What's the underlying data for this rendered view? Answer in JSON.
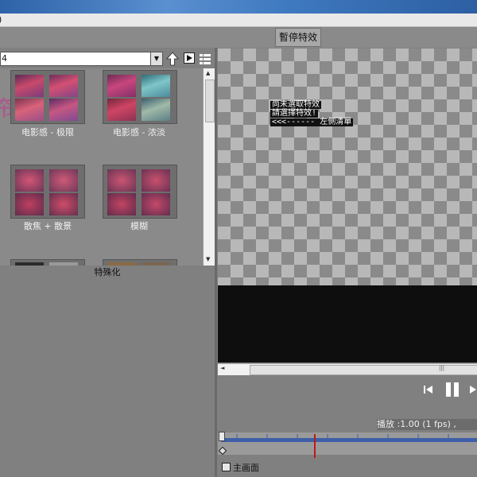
{
  "titlebar": {
    "title": ")"
  },
  "header": {
    "stop_effect_button": "暫停特效"
  },
  "browser": {
    "combo_value": "4",
    "tiles": [
      {
        "label": "电影感 - 极限"
      },
      {
        "label": "电影感 - 浓淡"
      },
      {
        "label": "散焦 + 散景"
      },
      {
        "label": "模糊"
      }
    ],
    "caption": "特殊化"
  },
  "preview": {
    "message_lines": [
      "尚未選取特效",
      "請選擇特效!",
      "<<<------ 左側清單"
    ]
  },
  "transport": {
    "status_text": "播放 :1.00 (1    fps) ,"
  },
  "options": {
    "main_screen_label": "主画面"
  },
  "colors": {
    "timeline_bar": "#3f5fa8",
    "playhead": "#c01818"
  }
}
